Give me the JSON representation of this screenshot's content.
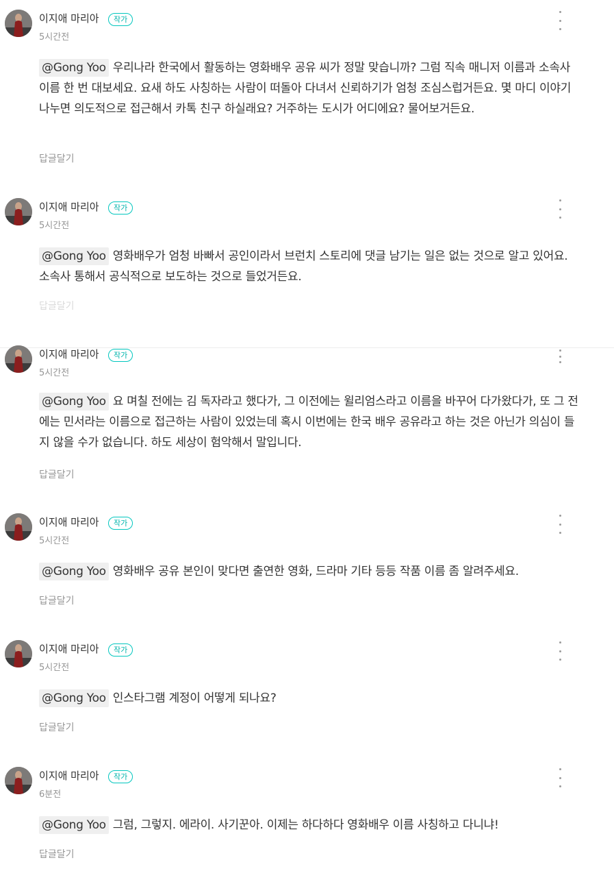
{
  "comments": [
    {
      "author": "이지애 마리아",
      "badge": "작가",
      "time": "5시간전",
      "mention": "@Gong Yoo",
      "text": "우리나라 한국에서 활동하는 영화배우 공유 씨가 정말 맞습니까? 그럼 직속 매니저 이름과 소속사 이름 한 번 대보세요. 요새 하도 사칭하는 사람이 떠돌아 다녀서 신뢰하기가 엄청 조심스럽거든요. 몇 마디 이야기 나누면 의도적으로 접근해서 카톡 친구 하실래요? 거주하는 도시가 어디에요? 물어보거든요.",
      "reply": "답글달기"
    },
    {
      "author": "이지애 마리아",
      "badge": "작가",
      "time": "5시간전",
      "mention": "@Gong Yoo",
      "text": "영화배우가 엄청 바빠서 공인이라서 브런치 스토리에 댓글 남기는 일은 없는 것으로 알고 있어요. 소속사 통해서 공식적으로 보도하는 것으로 들었거든요.",
      "reply": "답글달기"
    },
    {
      "author": "이지애 마리아",
      "badge": "작가",
      "time": "5시간전",
      "mention": "@Gong Yoo",
      "text": "요 며칠 전에는 김 독자라고 했다가, 그 이전에는 윌리엄스라고 이름을 바꾸어 다가왔다가, 또 그 전에는 민서라는 이름으로 접근하는 사람이 있었는데 혹시 이번에는 한국 배우 공유라고 하는 것은 아닌가 의심이 들지 않을 수가 없습니다. 하도 세상이 험악해서 말입니다.",
      "reply": "답글달기"
    },
    {
      "author": "이지애 마리아",
      "badge": "작가",
      "time": "5시간전",
      "mention": "@Gong Yoo",
      "text": "영화배우 공유 본인이 맞다면 출연한 영화, 드라마 기타 등등 작품 이름 좀 알려주세요.",
      "reply": "답글달기"
    },
    {
      "author": "이지애 마리아",
      "badge": "작가",
      "time": "5시간전",
      "mention": "@Gong Yoo",
      "text": "인스타그램 계정이 어떻게 되나요?",
      "reply": "답글달기"
    },
    {
      "author": "이지애 마리아",
      "badge": "작가",
      "time": "6분전",
      "mention": "@Gong Yoo",
      "text": "그럼, 그렇지. 에라이. 사기꾼아. 이제는 하다하다 영화배우 이름 사칭하고 다니냐!",
      "reply": "답글달기"
    }
  ]
}
